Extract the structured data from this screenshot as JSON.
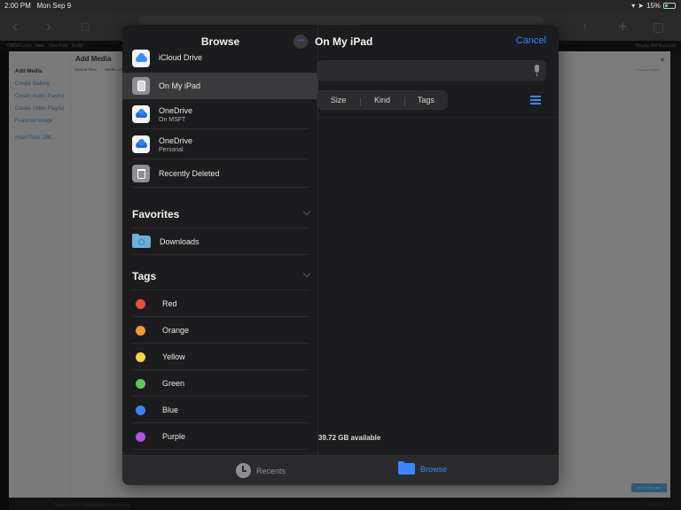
{
  "status_bar": {
    "time": "2:00 PM",
    "date": "Mon Sep 9",
    "battery": "15%"
  },
  "safari": {
    "url": "osmsft.com"
  },
  "background_page": {
    "admin_bar": {
      "site": "OMSFT.com",
      "new": "New",
      "view_post": "View Post",
      "extra": "Drafts",
      "greeting": "Howdy, Arif Bacchus"
    },
    "modal": {
      "menu": [
        "Add Media",
        "Create Gallery",
        "Create Audio Playlist",
        "Create Video Playlist",
        "Featured Image",
        "Insert from URL"
      ],
      "title": "Add Media",
      "tabs": [
        "Upload Files",
        "Media Library"
      ],
      "expand_details": "Expand Details",
      "insert_button": "Insert into post"
    },
    "footer": "Thank you for creating with WordPress.",
    "version": "Version 5.2.2"
  },
  "picker": {
    "sidebar": {
      "title": "Browse",
      "locations": [
        {
          "label": "iCloud Drive",
          "sub": "",
          "icon": "icloud-icon"
        },
        {
          "label": "On My iPad",
          "sub": "",
          "icon": "ipad-icon",
          "selected": true
        },
        {
          "label": "OneDrive",
          "sub": "On MSFT",
          "icon": "onedrive-icon"
        },
        {
          "label": "OneDrive",
          "sub": "Personal",
          "icon": "onedrive-icon"
        },
        {
          "label": "Recently Deleted",
          "sub": "",
          "icon": "trash-icon"
        }
      ],
      "favorites": {
        "title": "Favorites",
        "items": [
          {
            "label": "Downloads",
            "icon": "downloads-folder-icon"
          }
        ]
      },
      "tags": {
        "title": "Tags",
        "items": [
          {
            "label": "Red",
            "color": "#eb4d3d"
          },
          {
            "label": "Orange",
            "color": "#f09a37"
          },
          {
            "label": "Yellow",
            "color": "#f7d547"
          },
          {
            "label": "Green",
            "color": "#5ac85a"
          },
          {
            "label": "Blue",
            "color": "#3a82f7"
          },
          {
            "label": "Purple",
            "color": "#af52de"
          }
        ]
      }
    },
    "main": {
      "title": "On My iPad",
      "cancel": "Cancel",
      "search_placeholder": "",
      "sort_options": [
        "Size",
        "Kind",
        "Tags"
      ],
      "available": "39.72 GB available"
    },
    "tabbar": {
      "recents": "Recents",
      "browse": "Browse"
    },
    "accent": "#3a86ff"
  }
}
